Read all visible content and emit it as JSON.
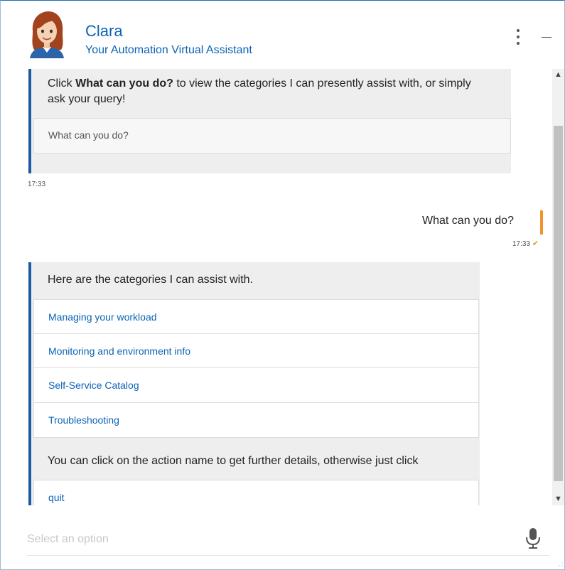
{
  "header": {
    "name": "Clara",
    "subtitle": "Your Automation Virtual Assistant"
  },
  "messages": {
    "intro": {
      "text_prefix": "Click ",
      "text_bold": "What can you do?",
      "text_suffix": " to view the categories I can presently assist with, or simply ask your query!",
      "option": "What can you do?",
      "time": "17:33"
    },
    "user": {
      "text": "What can you do?",
      "time": "17:33"
    },
    "categories": {
      "heading": "Here are the categories I can assist with.",
      "items": [
        "Managing your workload",
        "Monitoring and environment info",
        "Self-Service Catalog",
        "Troubleshooting"
      ],
      "footer_text": "You can click on the action name to get further details, otherwise just click",
      "quit_label": "quit"
    }
  },
  "input": {
    "placeholder": "Select an option"
  },
  "colors": {
    "brand_blue": "#0b63b5",
    "bot_border": "#1c5aa6",
    "user_accent": "#f0952e"
  },
  "icons": {
    "menu": "vertical-ellipsis-icon",
    "minimize": "minimize-icon",
    "microphone": "microphone-icon",
    "scroll_up": "chevron-up-icon",
    "scroll_down": "chevron-down-icon",
    "read_receipt": "check-icon"
  }
}
